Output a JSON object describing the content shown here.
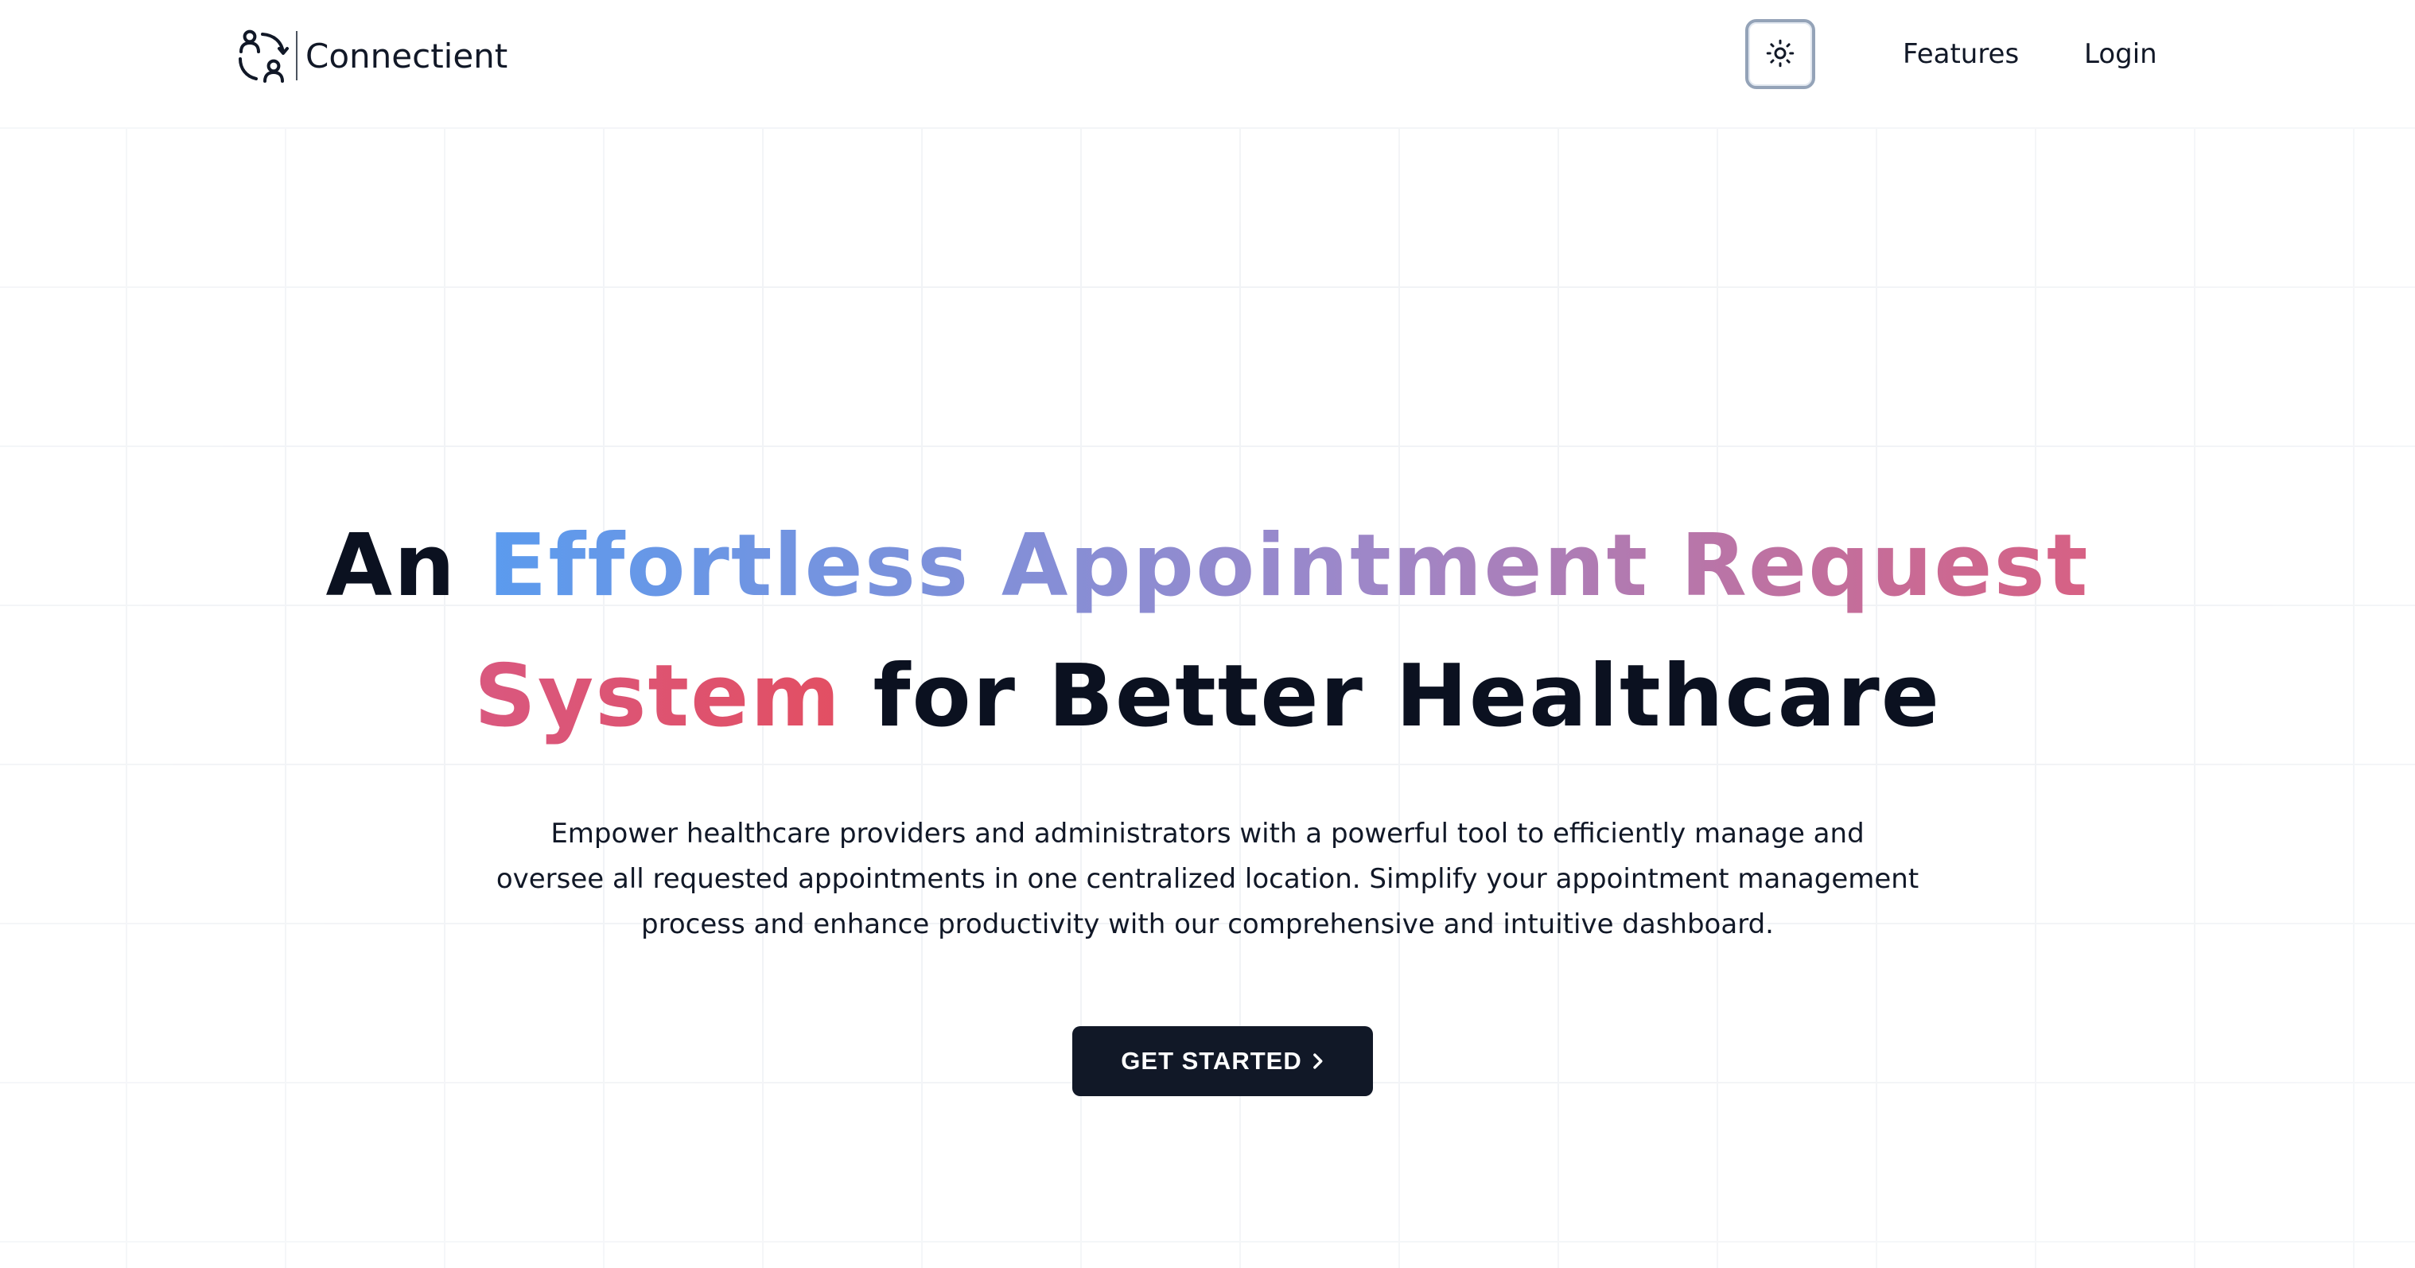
{
  "brand": {
    "name": "Connectient",
    "logo_icon": "users-connect-icon"
  },
  "header": {
    "theme_toggle_icon": "sun-icon",
    "nav": [
      {
        "label": "Features"
      },
      {
        "label": "Login"
      }
    ]
  },
  "hero": {
    "title_line1_plain": "An ",
    "title_line1_gradient": "Effortless Appointment Request",
    "title_line2_gradient": "System",
    "title_line2_plain": " for Better Healthcare",
    "subtitle": "Empower healthcare providers and administrators with a powerful tool to efficiently manage and oversee all requested appointments in one centralized location. Simplify your appointment management process and enhance productivity with our comprehensive and intuitive dashboard.",
    "cta_label": "GET STARTED",
    "cta_icon": "chevron-right-icon"
  },
  "colors": {
    "gradient_start": "#5b9bee",
    "gradient_mid": "#9e87c8",
    "gradient_end": "#e24f63",
    "cta_background": "#111827",
    "text_dark": "#0b1120"
  }
}
